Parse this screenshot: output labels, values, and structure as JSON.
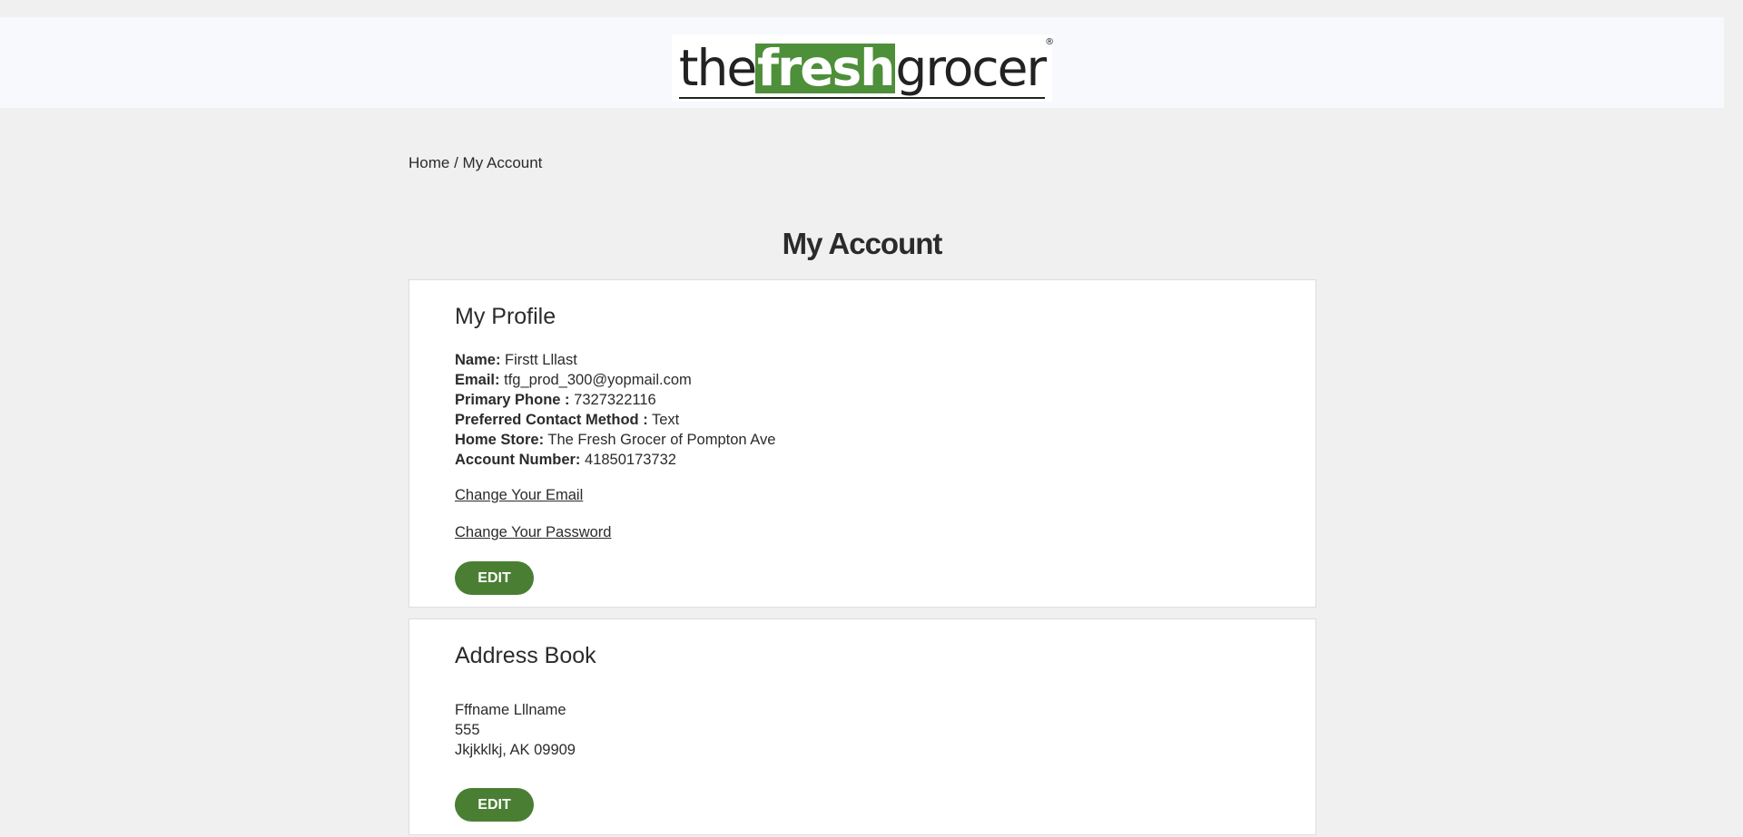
{
  "header": {
    "logo": {
      "part1": "the",
      "part2": "fresh",
      "part3": "grocer",
      "reg": "®"
    },
    "brand_color": "#4e8f3a"
  },
  "breadcrumb": {
    "home": "Home",
    "separator": " / ",
    "current": "My Account"
  },
  "page_title": "My Account",
  "profile": {
    "heading": "My Profile",
    "fields": [
      {
        "label": "Name:",
        "value": "Firstt Lllast"
      },
      {
        "label": "Email:",
        "value": "tfg_prod_300@yopmail.com"
      },
      {
        "label": "Primary Phone :",
        "value": "7327322116"
      },
      {
        "label": "Preferred Contact Method :",
        "value": "Text"
      },
      {
        "label": "Home Store:",
        "value": "The Fresh Grocer of Pompton Ave"
      },
      {
        "label": "Account Number:",
        "value": "41850173732"
      }
    ],
    "change_email": "Change Your Email",
    "change_password": "Change Your Password",
    "edit_label": "EDIT"
  },
  "address_book": {
    "heading": "Address Book",
    "lines": [
      "Fffname Lllname",
      "555",
      "Jkjkklkj, AK 09909"
    ],
    "edit_label": "EDIT"
  },
  "colors": {
    "button": "#4a7f33",
    "page_bg": "#f0f0f0",
    "header_bg": "#f7f9fd"
  }
}
